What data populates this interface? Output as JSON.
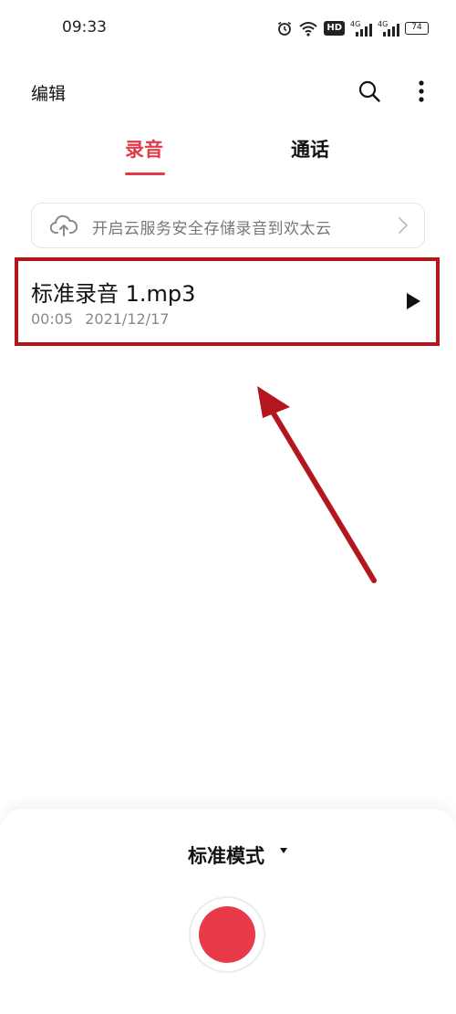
{
  "status_bar": {
    "time": "09:33",
    "hd_label": "HD",
    "signal_1_label": "4G",
    "signal_2_label": "4G",
    "battery": "74"
  },
  "header": {
    "edit_label": "编辑",
    "icons": [
      "search-icon",
      "more-vertical-icon"
    ]
  },
  "tabs": [
    {
      "label": "录音",
      "active": true
    },
    {
      "label": "通话",
      "active": false
    }
  ],
  "cloud_banner": {
    "text": "开启云服务安全存储录音到欢太云",
    "icon": "cloud-upload-icon"
  },
  "recordings": [
    {
      "name": "标准录音 1.mp3",
      "duration": "00:05",
      "date": "2021/12/17"
    }
  ],
  "record_panel": {
    "mode_label": "标准模式"
  },
  "colors": {
    "accent": "#e23a48",
    "highlight_frame": "#b3171d",
    "annotation_arrow": "#b3171d",
    "record_button": "#e83a48"
  }
}
